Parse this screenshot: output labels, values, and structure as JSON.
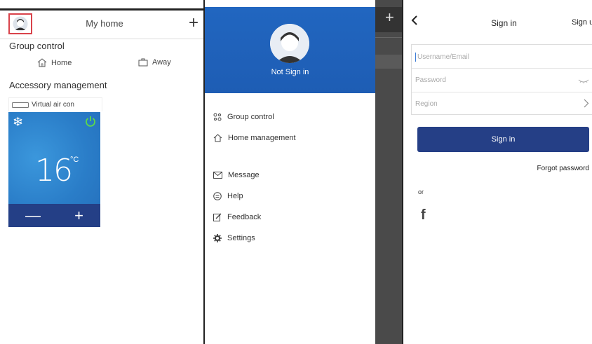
{
  "home_screen": {
    "title": "My home",
    "add_icon": "plus-icon",
    "group_control_label": "Group control",
    "modes": [
      {
        "label": "Home",
        "icon": "house-icon"
      },
      {
        "label": "Away",
        "icon": "suitcase-icon"
      }
    ],
    "accessory_label": "Accessory management",
    "device_name": "Virtual air con",
    "ac": {
      "temperature": "16",
      "unit": "°C",
      "mode_icon": "snowflake-icon",
      "power_icon": "power-icon",
      "decrease_label": "—",
      "increase_label": "+"
    }
  },
  "drawer": {
    "status": "Not Sign in",
    "items": [
      {
        "label": "Group control",
        "icon": "group-icon"
      },
      {
        "label": "Home management",
        "icon": "house-icon"
      },
      {
        "label": "Message",
        "icon": "mail-icon"
      },
      {
        "label": "Help",
        "icon": "help-icon"
      },
      {
        "label": "Feedback",
        "icon": "feedback-icon"
      },
      {
        "label": "Settings",
        "icon": "gear-icon"
      }
    ],
    "overlay_plus": "+"
  },
  "signin_screen": {
    "title": "Sign in",
    "signup_label": "Sign u",
    "username_placeholder": "Username/Email",
    "password_placeholder": "Password",
    "region_placeholder": "Region",
    "button_label": "Sign in",
    "forgot_label": "Forgot password",
    "or_label": "or",
    "social_icon": "facebook-icon",
    "social_glyph": "f"
  },
  "colors": {
    "accent_blue": "#1e5db4",
    "button_navy": "#253f86",
    "power_green": "#5dd94a",
    "highlight_red": "#d9434b"
  }
}
